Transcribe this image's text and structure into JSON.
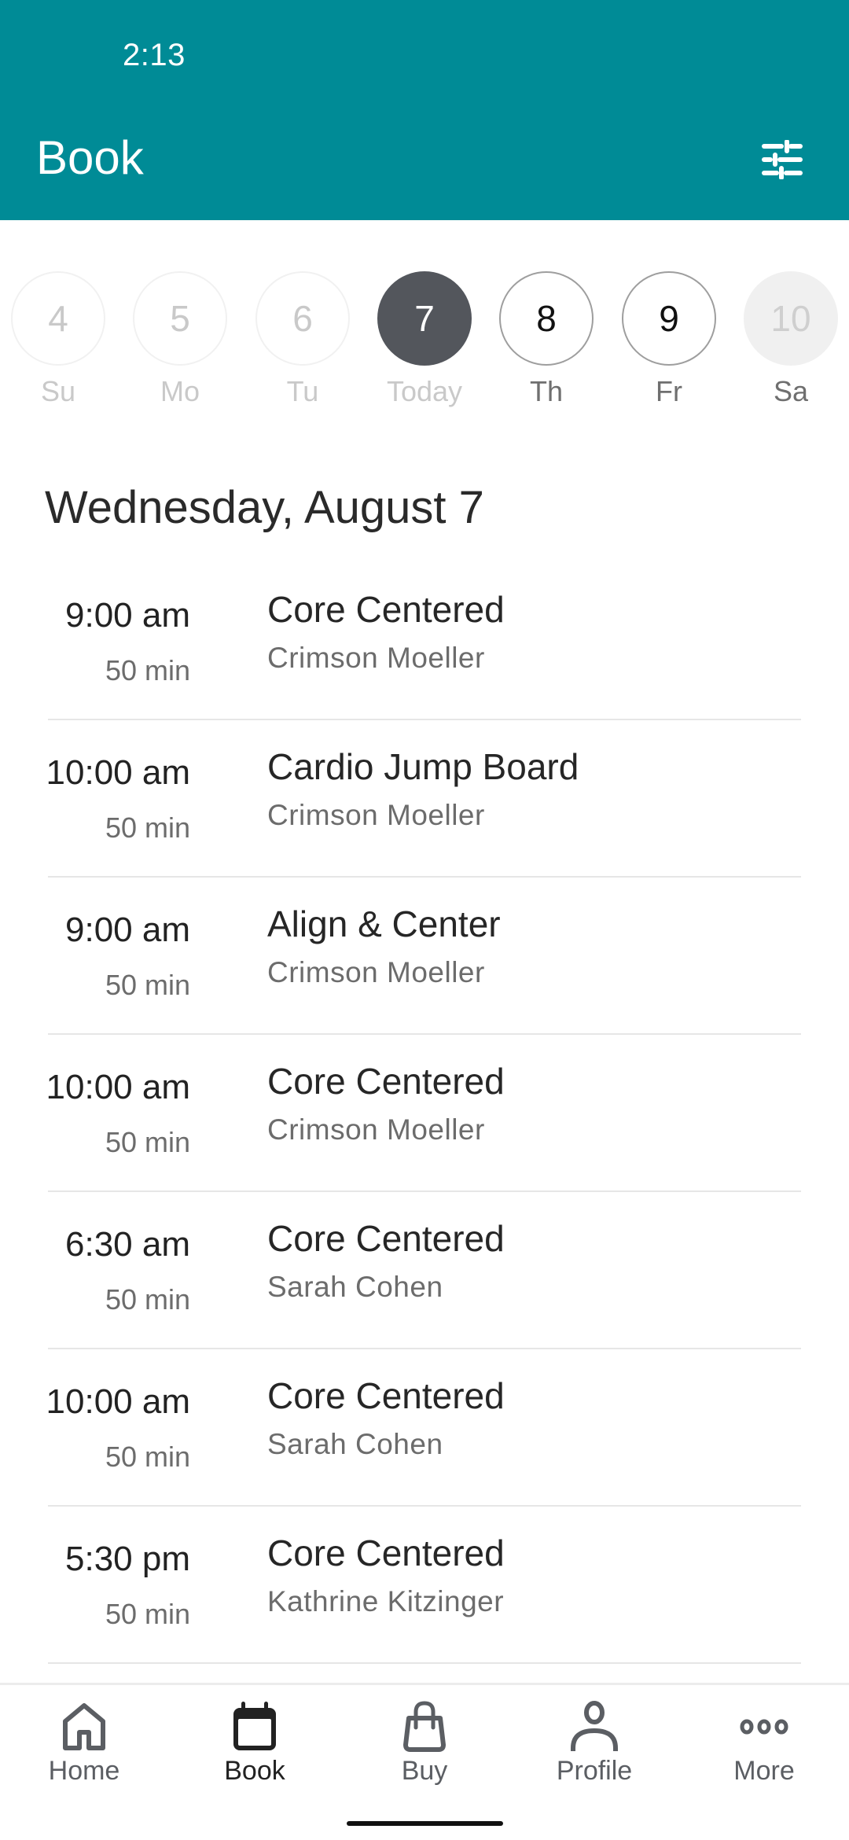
{
  "status_bar": {
    "time": "2:13"
  },
  "header": {
    "title": "Book",
    "filter_icon": "sliders-icon",
    "background_color": "#008B96"
  },
  "day_strip": {
    "days": [
      {
        "number": "4",
        "label": "Su",
        "state": "past"
      },
      {
        "number": "5",
        "label": "Mo",
        "state": "past"
      },
      {
        "number": "6",
        "label": "Tu",
        "state": "past"
      },
      {
        "number": "7",
        "label": "Today",
        "state": "selected"
      },
      {
        "number": "8",
        "label": "Th",
        "state": "future"
      },
      {
        "number": "9",
        "label": "Fr",
        "state": "future"
      },
      {
        "number": "10",
        "label": "Sa",
        "state": "disabled"
      }
    ],
    "selected_color": "#53565C"
  },
  "date_heading": "Wednesday, August 7",
  "classes": [
    {
      "time": "9:00 am",
      "duration": "50 min",
      "name": "Core Centered",
      "instructor": "Crimson Moeller"
    },
    {
      "time": "10:00 am",
      "duration": "50 min",
      "name": "Cardio Jump Board",
      "instructor": "Crimson Moeller"
    },
    {
      "time": "9:00 am",
      "duration": "50 min",
      "name": "Align & Center",
      "instructor": "Crimson Moeller"
    },
    {
      "time": "10:00 am",
      "duration": "50 min",
      "name": "Core Centered",
      "instructor": "Crimson Moeller"
    },
    {
      "time": "6:30 am",
      "duration": "50 min",
      "name": "Core Centered",
      "instructor": "Sarah Cohen"
    },
    {
      "time": "10:00 am",
      "duration": "50 min",
      "name": "Core Centered",
      "instructor": "Sarah Cohen"
    },
    {
      "time": "5:30 pm",
      "duration": "50 min",
      "name": "Core Centered",
      "instructor": "Kathrine Kitzinger"
    }
  ],
  "bottom_nav": {
    "items": [
      {
        "label": "Home",
        "icon": "home-icon",
        "active": false
      },
      {
        "label": "Book",
        "icon": "calendar-icon",
        "active": true
      },
      {
        "label": "Buy",
        "icon": "shopping-bag-icon",
        "active": false
      },
      {
        "label": "Profile",
        "icon": "person-icon",
        "active": false
      },
      {
        "label": "More",
        "icon": "more-dots-icon",
        "active": false
      }
    ]
  }
}
